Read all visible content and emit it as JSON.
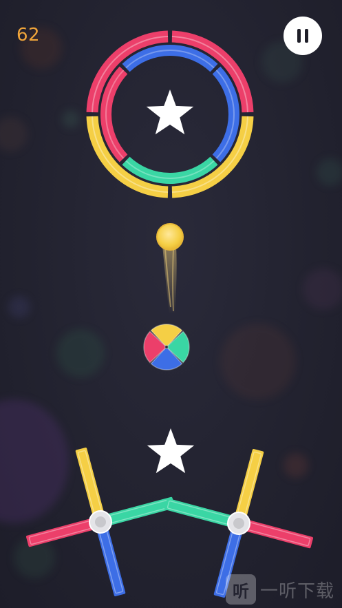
{
  "hud": {
    "score": "62",
    "pause_icon": "pause-icon"
  },
  "colors": {
    "background": "#22222f",
    "yellow": "#f5cf45",
    "red": "#ec3f6a",
    "green": "#3ad6a4",
    "blue": "#3d6ee6",
    "star": "#ffffff",
    "score": "#f0a53a"
  },
  "objects": {
    "ring_segments": [
      "red",
      "yellow",
      "yellow",
      "red",
      "blue",
      "green",
      "blue",
      "green"
    ],
    "color_switcher_quadrants": [
      "yellow",
      "green",
      "blue",
      "red"
    ],
    "player_ball_color": "yellow",
    "stars": [
      "star-icon",
      "star-icon"
    ],
    "left_cross_arms": [
      "yellow",
      "green",
      "blue",
      "red"
    ],
    "right_cross_arms": [
      "yellow",
      "red",
      "blue",
      "green"
    ]
  },
  "watermark": {
    "icon_glyph": "听",
    "text": "一听下载"
  }
}
